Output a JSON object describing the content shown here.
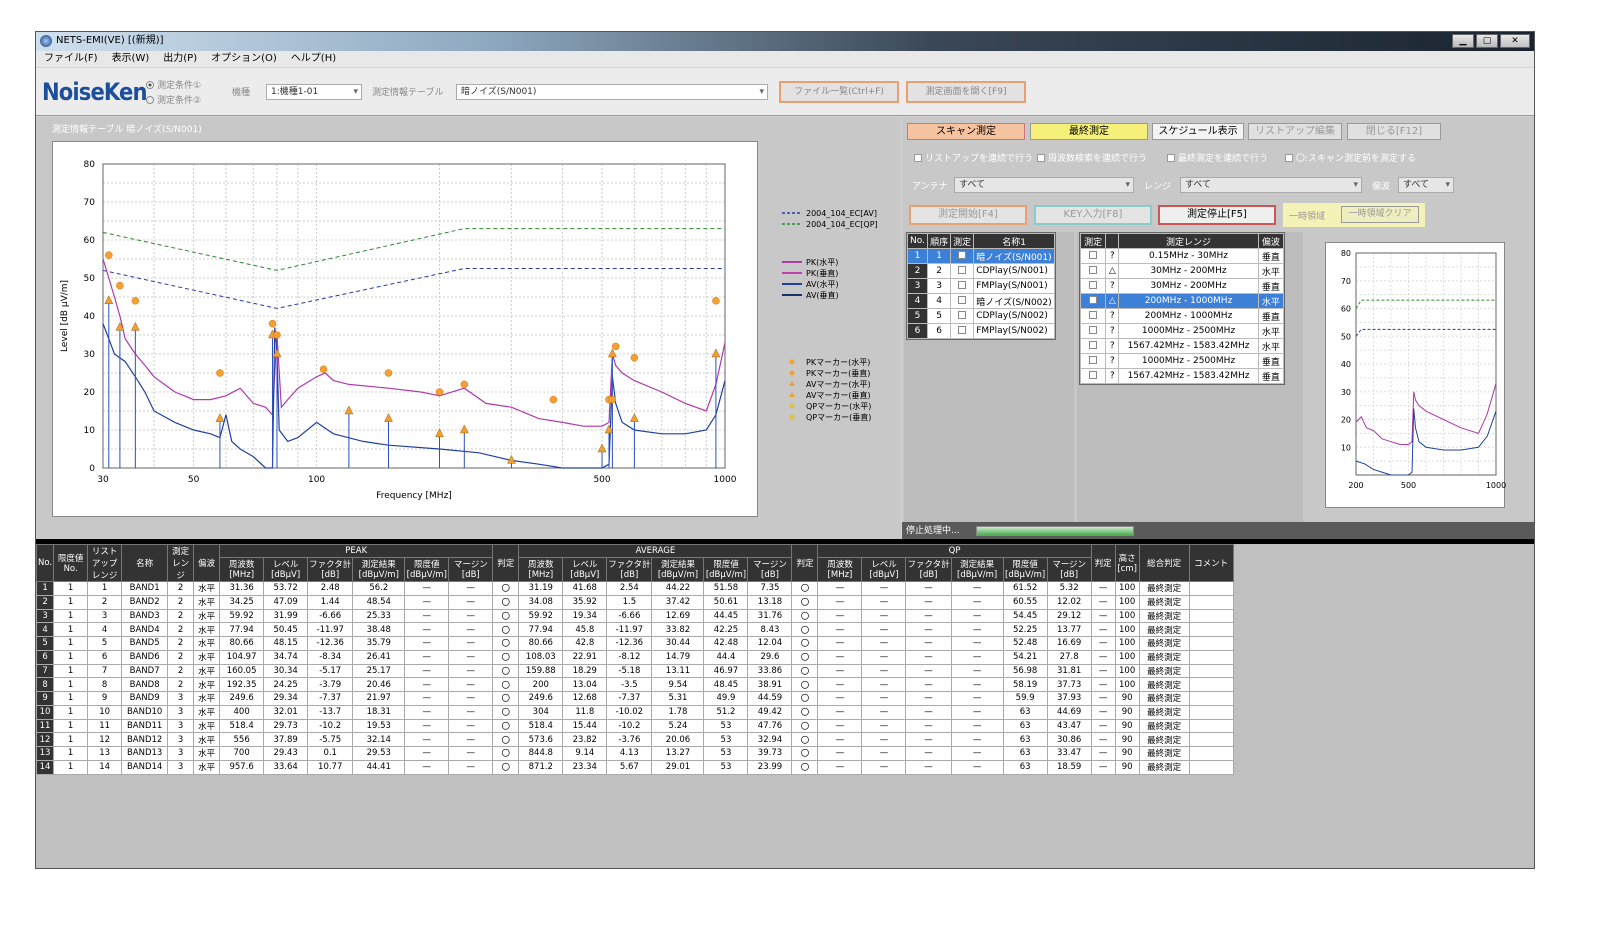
{
  "window": {
    "title": "NETS-EMI(VE) [(新規)]",
    "min": "▁",
    "max": "▢",
    "close": "✕"
  },
  "menu": [
    "ファイル(F)",
    "表示(W)",
    "出力(P)",
    "オプション(O)",
    "ヘルプ(H)"
  ],
  "toolbar": {
    "logo": "NoiseKen",
    "radio1": "測定条件①",
    "radio2": "測定条件②",
    "kishu_label": "機種",
    "kishu_value": "1:機種1-01",
    "table_label": "測定情報テーブル",
    "table_value": "暗ノイズ(S/N001)",
    "file_btn": "ファイル一覧(Ctrl+F)",
    "open_btn": "測定画面を開く[F9]"
  },
  "chart_caption": "測定情報テーブル 暗ノイズ(S/N001)",
  "chart_data": {
    "type": "line",
    "xlabel": "Frequency [MHz]",
    "ylabel": "Level [dB μV/m]",
    "xscale": "log",
    "xlim": [
      30,
      1000
    ],
    "ylim": [
      0,
      80
    ],
    "xticks": [
      30,
      50,
      100,
      500,
      1000
    ],
    "yticks": [
      0,
      10,
      20,
      30,
      40,
      50,
      60,
      70,
      80
    ],
    "limits": [
      {
        "name": "2004_104_EC[AV]",
        "color": "#2a3aa8",
        "x": [
          30,
          80,
          230,
          1000
        ],
        "y": [
          52,
          42,
          52.5,
          52.5
        ]
      },
      {
        "name": "2004_104_EC[QP]",
        "color": "#2a8a2a",
        "x": [
          30,
          80,
          230,
          1000
        ],
        "y": [
          62,
          52,
          63,
          63
        ]
      }
    ],
    "series": [
      {
        "name": "PK(水平)",
        "color": "#b03aa8"
      },
      {
        "name": "PK(垂直)",
        "color": "#c040b0"
      },
      {
        "name": "AV(水平)",
        "color": "#2040a0"
      },
      {
        "name": "AV(垂直)",
        "color": "#2a50c0"
      }
    ],
    "pk_trace": {
      "x": [
        30,
        31,
        32,
        33,
        34,
        36,
        38,
        40,
        45,
        50,
        55,
        60,
        65,
        70,
        75,
        78,
        80,
        82,
        85,
        90,
        100,
        105,
        110,
        120,
        150,
        180,
        200,
        230,
        260,
        300,
        350,
        400,
        450,
        500,
        520,
        530,
        540,
        560,
        600,
        700,
        800,
        900,
        950,
        1000
      ],
      "y": [
        55,
        50,
        45,
        40,
        34,
        30,
        27,
        24,
        20,
        18,
        18,
        19,
        21,
        17,
        16,
        14,
        35,
        16,
        18,
        21,
        24,
        25,
        23,
        22,
        21,
        20,
        19,
        21,
        17,
        16,
        13,
        12,
        11,
        11,
        12,
        30,
        27,
        25,
        23,
        20,
        17,
        15,
        22,
        33
      ]
    },
    "av_trace": {
      "x": [
        30,
        31,
        32,
        34,
        36,
        38,
        40,
        45,
        50,
        55,
        58,
        60,
        62,
        65,
        70,
        75,
        78,
        79,
        80,
        81,
        85,
        90,
        100,
        110,
        130,
        150,
        200,
        250,
        300,
        350,
        400,
        500,
        520,
        530,
        540,
        560,
        600,
        700,
        800,
        900,
        950,
        1000
      ],
      "y": [
        38,
        34,
        30,
        28,
        24,
        20,
        15,
        12,
        10,
        9,
        8,
        14,
        7,
        5,
        3,
        0,
        0,
        37,
        30,
        10,
        7,
        8,
        12,
        9,
        7,
        6,
        5,
        4,
        2,
        1,
        0,
        0,
        1,
        24,
        17,
        12,
        10,
        9,
        9,
        10,
        14,
        23
      ]
    },
    "pk_markers": {
      "x": [
        31,
        33,
        36,
        58,
        78,
        80,
        104,
        150,
        200,
        230,
        380,
        520,
        530,
        540,
        600,
        950
      ],
      "y": [
        56,
        48,
        44,
        25,
        38,
        35,
        26,
        25,
        20,
        22,
        18,
        18,
        18,
        32,
        29,
        44
      ]
    },
    "av_markers": {
      "x": [
        31,
        33,
        36,
        58,
        78,
        80,
        120,
        150,
        200,
        230,
        300,
        500,
        520,
        530,
        600,
        950
      ],
      "y": [
        44,
        37,
        37,
        13,
        35,
        30,
        15,
        13,
        9,
        10,
        2,
        5,
        10,
        30,
        13,
        30
      ]
    },
    "legend_limits": [
      "2004_104_EC[AV]",
      "2004_104_EC[QP]"
    ],
    "legend_traces": [
      "PK(水平)",
      "PK(垂直)",
      "AV(水平)",
      "AV(垂直)"
    ],
    "legend_markers": [
      "PKマーカー(水平)",
      "PKマーカー(垂直)",
      "AVマーカー(水平)",
      "AVマーカー(垂直)",
      "QPマーカー(水平)",
      "QPマーカー(垂直)"
    ],
    "mini": {
      "xticks": [
        200,
        500,
        1000
      ],
      "yticks": [
        10,
        20,
        30,
        40,
        50,
        60,
        70,
        80
      ],
      "xlim": [
        200,
        1000
      ],
      "ylim": [
        0,
        80
      ]
    }
  },
  "right": {
    "scan_btn": "スキャン測定",
    "final_btn": "最終測定",
    "schedule_btn": "スケジュール表示",
    "listup_btn": "リストアップ編集",
    "close_btn": "閉じる[F12]",
    "chk1": "リストアップを連続で行う",
    "chk2": "周波数検索を連続で行う",
    "chk3": "最終測定を連続で行う",
    "chk4": "〇:スキャン測定前を測定する",
    "antenna_label": "アンテナ",
    "antenna_value": "すべて",
    "range_label": "レンジ",
    "range_value": "すべて",
    "pol_label": "偏波",
    "pol_value": "すべて",
    "start_btn": "測定開始[F4]",
    "key_btn": "KEY入力[F8]",
    "stop_btn": "測定停止[F5]",
    "pause_label": "一時領域",
    "pause_clear_btn": "一時領域クリア",
    "list_head": [
      "No.",
      "順序",
      "測定",
      "名称1"
    ],
    "list_rows": [
      [
        "1",
        "1",
        "暗ノイズ(S/N001)"
      ],
      [
        "2",
        "2",
        "CDPlay(S/N001)"
      ],
      [
        "3",
        "3",
        "FMPlay(S/N001)"
      ],
      [
        "4",
        "4",
        "暗ノイズ(S/N002)"
      ],
      [
        "5",
        "5",
        "CDPlay(S/N002)"
      ],
      [
        "6",
        "6",
        "FMPlay(S/N002)"
      ]
    ],
    "range_head": [
      "測定",
      "",
      "測定レンジ",
      "偏波"
    ],
    "range_rows": [
      [
        "?",
        "0.15MHz - 30MHz",
        "垂直"
      ],
      [
        "△",
        "30MHz - 200MHz",
        "水平"
      ],
      [
        "?",
        "30MHz - 200MHz",
        "垂直"
      ],
      [
        "△",
        "200MHz - 1000MHz",
        "水平"
      ],
      [
        "?",
        "200MHz - 1000MHz",
        "垂直"
      ],
      [
        "?",
        "1000MHz - 2500MHz",
        "水平"
      ],
      [
        "?",
        "1567.42MHz - 1583.42MHz",
        "水平"
      ],
      [
        "?",
        "1000MHz - 2500MHz",
        "垂直"
      ],
      [
        "?",
        "1567.42MHz - 1583.42MHz",
        "垂直"
      ]
    ],
    "status": "停止処理中..."
  },
  "table": {
    "group_peak": "PEAK",
    "group_avg": "AVERAGE",
    "group_qp": "QP",
    "h_no": "No.",
    "h_limit": "限度値No.",
    "h_list": "リストアップレンジ",
    "h_name": "名称",
    "h_range": "測定レンジ",
    "h_pol": "偏波",
    "sub": [
      "周波数",
      "レベル",
      "ファクタ計",
      "測定結果",
      "限度値",
      "マージン"
    ],
    "units": [
      "[MHz]",
      "[dBμV]",
      "[dB]",
      "[dBμV/m]",
      "[dBμV/m]",
      "[dB]"
    ],
    "h_judge": "判定",
    "h_height": "高さ",
    "h_height_unit": "[cm]",
    "h_total": "総合判定",
    "h_comment": "コメント",
    "rows": [
      [
        "1",
        "1",
        "1",
        "BAND1",
        "2",
        "水平",
        "31.36",
        "53.72",
        "2.48",
        "56.2",
        "—",
        "—",
        "〇",
        "31.19",
        "41.68",
        "2.54",
        "44.22",
        "51.58",
        "7.35",
        "〇",
        "—",
        "—",
        "—",
        "—",
        "61.52",
        "5.32",
        "—",
        "100",
        "最終測定"
      ],
      [
        "2",
        "1",
        "2",
        "BAND2",
        "2",
        "水平",
        "34.25",
        "47.09",
        "1.44",
        "48.54",
        "—",
        "—",
        "〇",
        "34.08",
        "35.92",
        "1.5",
        "37.42",
        "50.61",
        "13.18",
        "〇",
        "—",
        "—",
        "—",
        "—",
        "60.55",
        "12.02",
        "—",
        "100",
        "最終測定"
      ],
      [
        "3",
        "1",
        "3",
        "BAND3",
        "2",
        "水平",
        "59.92",
        "31.99",
        "-6.66",
        "25.33",
        "—",
        "—",
        "〇",
        "59.92",
        "19.34",
        "-6.66",
        "12.69",
        "44.45",
        "31.76",
        "〇",
        "—",
        "—",
        "—",
        "—",
        "54.45",
        "29.12",
        "—",
        "100",
        "最終測定"
      ],
      [
        "4",
        "1",
        "4",
        "BAND4",
        "2",
        "水平",
        "77.94",
        "50.45",
        "-11.97",
        "38.48",
        "—",
        "—",
        "〇",
        "77.94",
        "45.8",
        "-11.97",
        "33.82",
        "42.25",
        "8.43",
        "〇",
        "—",
        "—",
        "—",
        "—",
        "52.25",
        "13.77",
        "—",
        "100",
        "最終測定"
      ],
      [
        "5",
        "1",
        "5",
        "BAND5",
        "2",
        "水平",
        "80.66",
        "48.15",
        "-12.36",
        "35.79",
        "—",
        "—",
        "〇",
        "80.66",
        "42.8",
        "-12.36",
        "30.44",
        "42.48",
        "12.04",
        "〇",
        "—",
        "—",
        "—",
        "—",
        "52.48",
        "16.69",
        "—",
        "100",
        "最終測定"
      ],
      [
        "6",
        "1",
        "6",
        "BAND6",
        "2",
        "水平",
        "104.97",
        "34.74",
        "-8.34",
        "26.41",
        "—",
        "—",
        "〇",
        "108.03",
        "22.91",
        "-8.12",
        "14.79",
        "44.4",
        "29.6",
        "〇",
        "—",
        "—",
        "—",
        "—",
        "54.21",
        "27.8",
        "—",
        "100",
        "最終測定"
      ],
      [
        "7",
        "1",
        "7",
        "BAND7",
        "2",
        "水平",
        "160.05",
        "30.34",
        "-5.17",
        "25.17",
        "—",
        "—",
        "〇",
        "159.88",
        "18.29",
        "-5.18",
        "13.11",
        "46.97",
        "33.86",
        "〇",
        "—",
        "—",
        "—",
        "—",
        "56.98",
        "31.81",
        "—",
        "100",
        "最終測定"
      ],
      [
        "8",
        "1",
        "8",
        "BAND8",
        "2",
        "水平",
        "192.35",
        "24.25",
        "-3.79",
        "20.46",
        "—",
        "—",
        "〇",
        "200",
        "13.04",
        "-3.5",
        "9.54",
        "48.45",
        "38.91",
        "〇",
        "—",
        "—",
        "—",
        "—",
        "58.19",
        "37.73",
        "—",
        "100",
        "最終測定"
      ],
      [
        "9",
        "1",
        "9",
        "BAND9",
        "3",
        "水平",
        "249.6",
        "29.34",
        "-7.37",
        "21.97",
        "—",
        "—",
        "〇",
        "249.6",
        "12.68",
        "-7.37",
        "5.31",
        "49.9",
        "44.59",
        "〇",
        "—",
        "—",
        "—",
        "—",
        "59.9",
        "37.93",
        "—",
        "90",
        "最終測定"
      ],
      [
        "10",
        "1",
        "10",
        "BAND10",
        "3",
        "水平",
        "400",
        "32.01",
        "-13.7",
        "18.31",
        "—",
        "—",
        "〇",
        "304",
        "11.8",
        "-10.02",
        "1.78",
        "51.2",
        "49.42",
        "〇",
        "—",
        "—",
        "—",
        "—",
        "63",
        "44.69",
        "—",
        "90",
        "最終測定"
      ],
      [
        "11",
        "1",
        "11",
        "BAND11",
        "3",
        "水平",
        "518.4",
        "29.73",
        "-10.2",
        "19.53",
        "—",
        "—",
        "〇",
        "518.4",
        "15.44",
        "-10.2",
        "5.24",
        "53",
        "47.76",
        "〇",
        "—",
        "—",
        "—",
        "—",
        "63",
        "43.47",
        "—",
        "90",
        "最終測定"
      ],
      [
        "12",
        "1",
        "12",
        "BAND12",
        "3",
        "水平",
        "556",
        "37.89",
        "-5.75",
        "32.14",
        "—",
        "—",
        "〇",
        "573.6",
        "23.82",
        "-3.76",
        "20.06",
        "53",
        "32.94",
        "〇",
        "—",
        "—",
        "—",
        "—",
        "63",
        "30.86",
        "—",
        "90",
        "最終測定"
      ],
      [
        "13",
        "1",
        "13",
        "BAND13",
        "3",
        "水平",
        "700",
        "29.43",
        "0.1",
        "29.53",
        "—",
        "—",
        "〇",
        "844.8",
        "9.14",
        "4.13",
        "13.27",
        "53",
        "39.73",
        "〇",
        "—",
        "—",
        "—",
        "—",
        "63",
        "33.47",
        "—",
        "90",
        "最終測定"
      ],
      [
        "14",
        "1",
        "14",
        "BAND14",
        "3",
        "水平",
        "957.6",
        "33.64",
        "10.77",
        "44.41",
        "—",
        "—",
        "〇",
        "871.2",
        "23.34",
        "5.67",
        "29.01",
        "53",
        "23.99",
        "〇",
        "—",
        "—",
        "—",
        "—",
        "63",
        "18.59",
        "—",
        "90",
        "最終測定"
      ]
    ]
  }
}
